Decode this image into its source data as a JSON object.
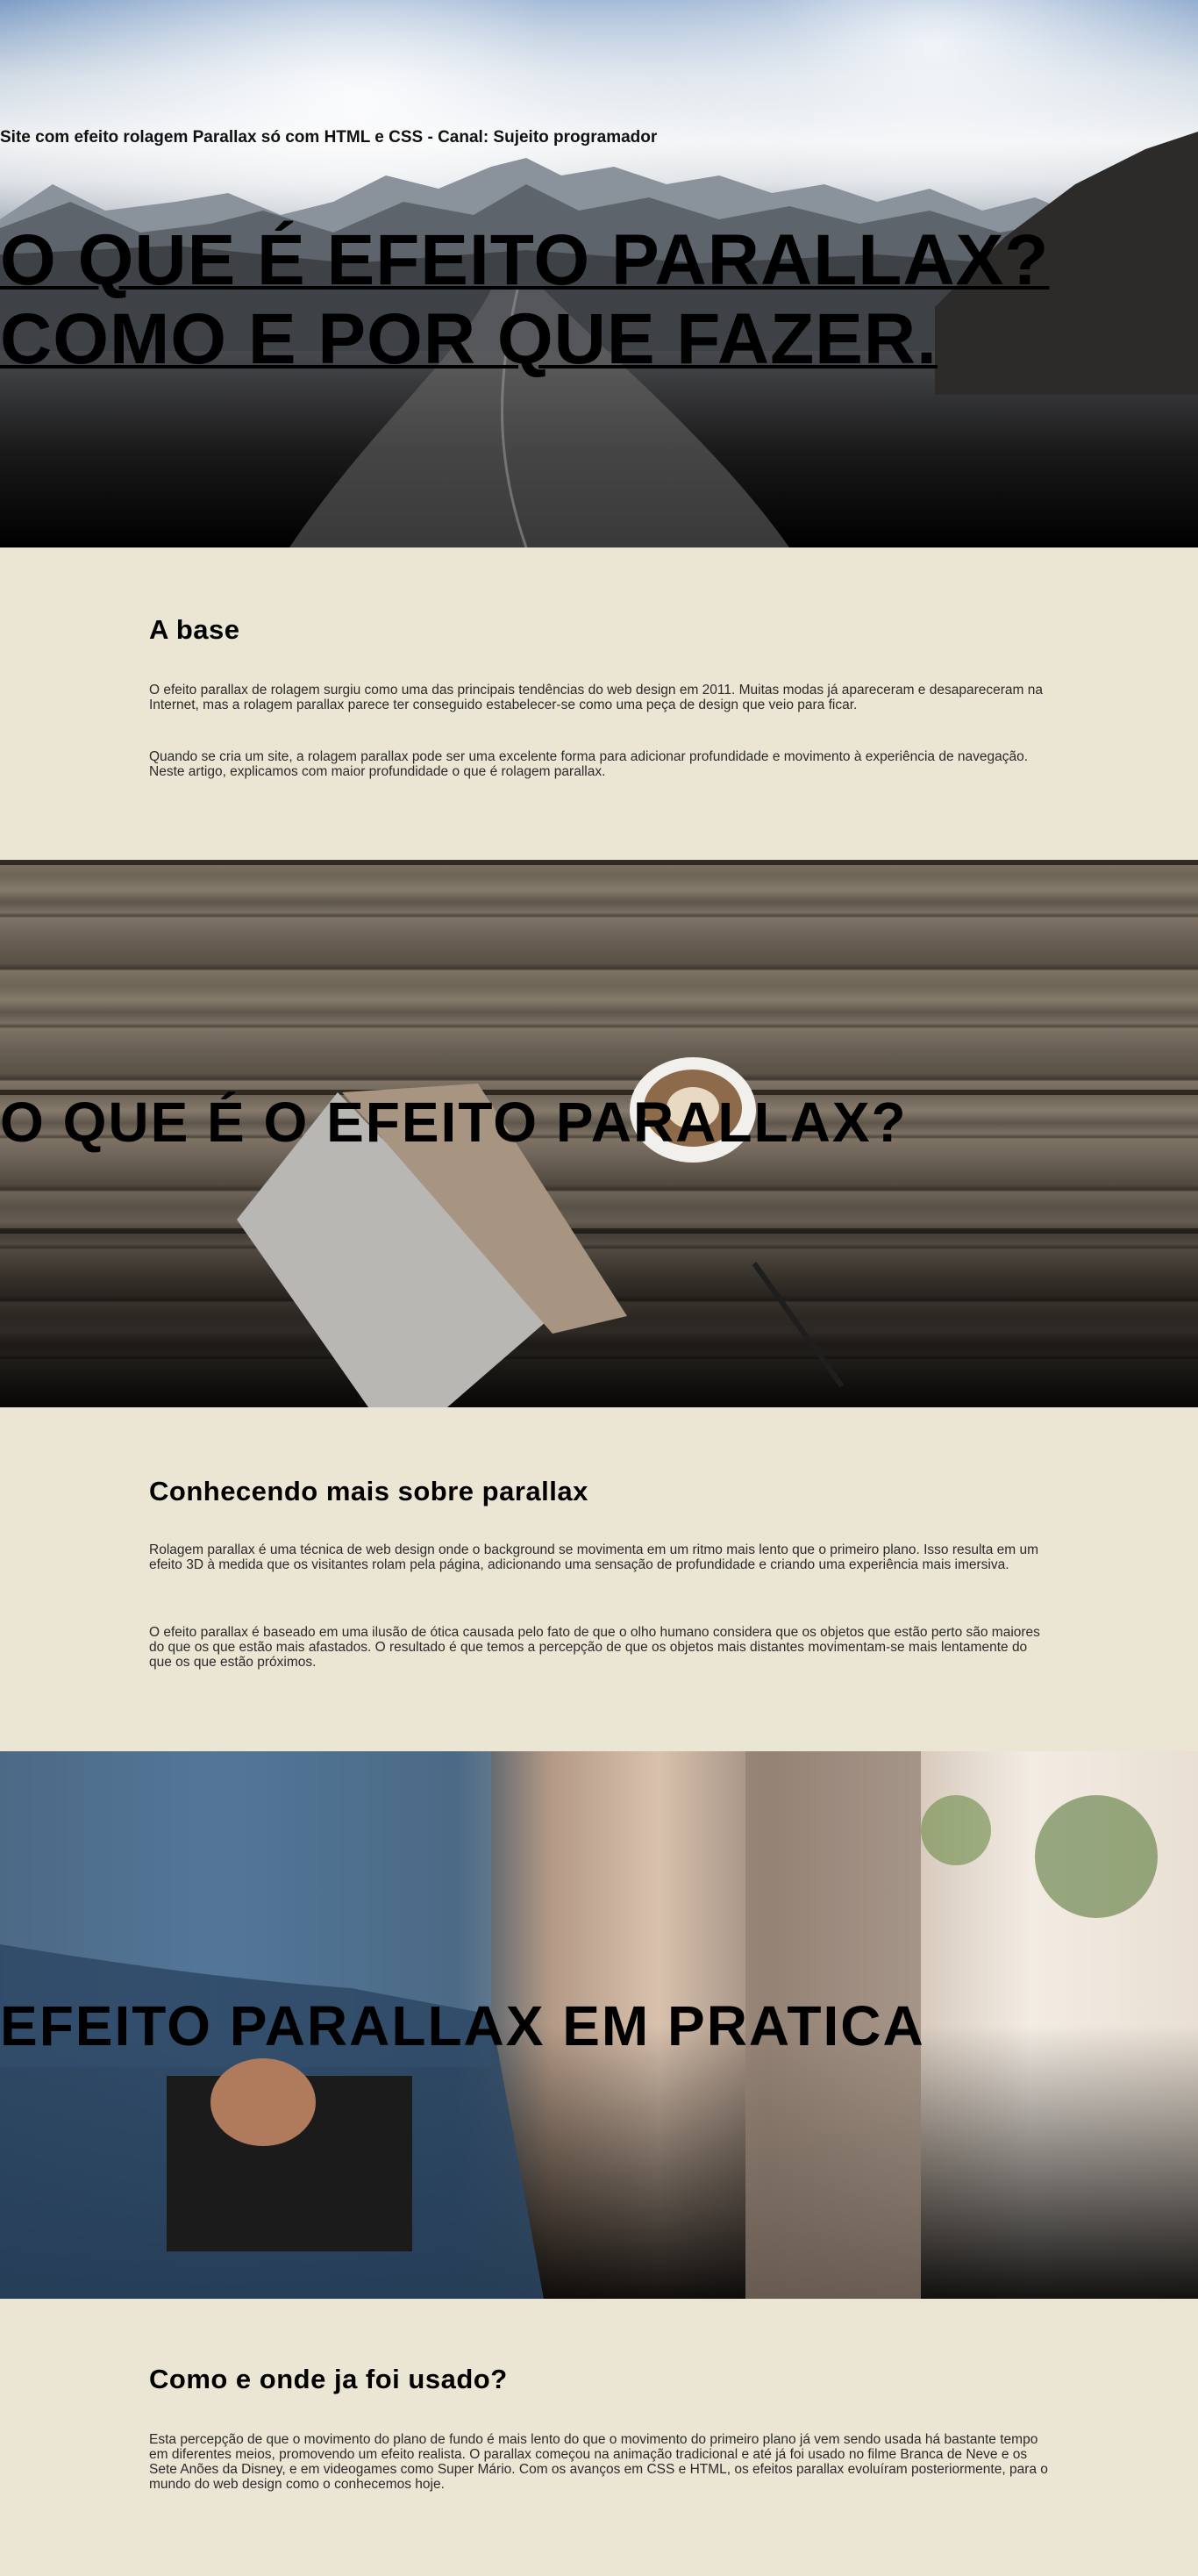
{
  "page": {
    "site_title": "Site com efeito rolagem Parallax só com HTML e CSS - Canal: Sujeito programador"
  },
  "hero1": {
    "title_line1": "O QUE É EFEITO PARALLAX?",
    "title_line2": "COMO E POR QUE FAZER."
  },
  "section1": {
    "heading": "A base",
    "paragraphs": [
      "O efeito parallax de rolagem surgiu como uma das principais tendências do web design em 2011. Muitas modas já apareceram e desapareceram na Internet, mas a rolagem parallax parece ter conseguido estabelecer-se como uma peça de design que veio para ficar.",
      "Quando se cria um site, a rolagem parallax pode ser uma excelente forma para adicionar profundidade e movimento à experiência de navegação. Neste artigo, explicamos com maior profundidade o que é rolagem parallax."
    ]
  },
  "hero2": {
    "title": "O QUE É O EFEITO PARALLAX?"
  },
  "section2": {
    "heading": "Conhecendo mais sobre parallax",
    "paragraphs": [
      "Rolagem parallax é uma técnica de web design onde o background se movimenta em um ritmo mais lento que o primeiro plano. Isso resulta em um efeito 3D à medida que os visitantes rolam pela página, adicionando uma sensação de profundidade e criando uma experiência mais imersiva.",
      "O efeito parallax é baseado em uma ilusão de ótica causada pelo fato de que o olho humano considera que os objetos que estão perto são maiores do que os que estão mais afastados. O resultado é que temos a percepção de que os objetos mais distantes movimentam-se mais lentamente do que os que estão próximos."
    ]
  },
  "hero3": {
    "title": "EFEITO PARALLAX EM PRATICA"
  },
  "section3": {
    "heading": "Como e onde ja foi usado?",
    "paragraphs": [
      "Esta percepção de que o movimento do plano de fundo é mais lento do que o movimento do primeiro plano já vem sendo usada há bastante tempo em diferentes meios, promovendo um efeito realista. O parallax começou na animação tradicional e até já foi usado no filme Branca de Neve e os Sete Anões da Disney, e em videogames como Super Mário. Com os avanços em CSS e HTML, os efeitos parallax evoluíram posteriormente, para o mundo do web design como o conhecemos hoje."
    ]
  },
  "colors": {
    "page_background": "#ebe5d3",
    "heading": "#000000",
    "body_text": "#2a2a2a"
  },
  "images": {
    "hero1": "mountain-road-photo",
    "hero2": "wood-table-coffee-photo",
    "hero3": "man-plaid-shirt-photo"
  }
}
